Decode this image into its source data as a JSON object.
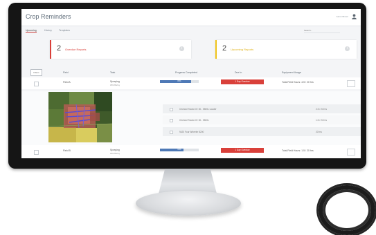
{
  "app": {
    "title": "Crop Reminders",
    "user_name": "Aaron Brown"
  },
  "tabs": [
    {
      "label": "Upcoming",
      "active": true
    },
    {
      "label": "History",
      "active": false
    },
    {
      "label": "Templates",
      "active": false
    }
  ],
  "search": {
    "placeholder": "Search..."
  },
  "cards": {
    "overdue": {
      "count": "2",
      "label": "Overdue Reports",
      "color": "#d9403a"
    },
    "upcoming": {
      "count": "2",
      "label": "Upcoming Reports",
      "color": "#f0c419"
    }
  },
  "table": {
    "filter_label": "Filters",
    "headers": {
      "field": "Field",
      "task": "Task",
      "progress": "Progress Completed",
      "due": "Due In",
      "equipment": "Equipment Usage"
    }
  },
  "rows": [
    {
      "field": "Field A",
      "task": "Spraying",
      "task_sub": "Wild Barley",
      "progress_text": "80%",
      "progress": 0.8,
      "due": "1 Day Overdue",
      "equipment": "Total Field Hours: 4.5 / 20 hrs"
    },
    {
      "field": "Field B",
      "task": "Spraying",
      "task_sub": "Wild Barley",
      "progress_text": "60%",
      "progress": 0.6,
      "due": "1 Day Overdue",
      "equipment": "Total Field Hours: 1.5 / 20 hrs"
    }
  ],
  "equipment_items": [
    {
      "name": "Orchard Tractor 8 / 30 - 5500L Loader",
      "hours": "2.5 / 24 hrs"
    },
    {
      "name": "Orchard Tractor 8 / 30 - 5500L",
      "hours": "1.5 / 24 hrs"
    },
    {
      "name": "9420 Four Wheeler 8200",
      "hours": "20 hrs"
    }
  ]
}
